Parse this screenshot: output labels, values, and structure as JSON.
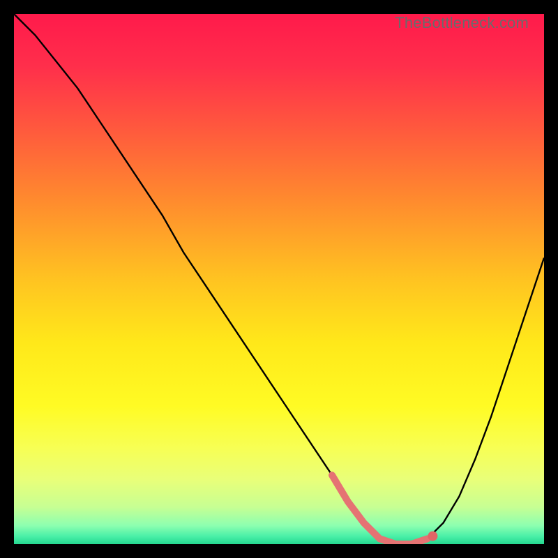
{
  "watermark": "TheBottleneck.com",
  "gradient_stops": [
    {
      "offset": 0.0,
      "color": "#ff1a4b"
    },
    {
      "offset": 0.1,
      "color": "#ff2f4b"
    },
    {
      "offset": 0.22,
      "color": "#ff5a3d"
    },
    {
      "offset": 0.35,
      "color": "#ff8a2e"
    },
    {
      "offset": 0.5,
      "color": "#ffc321"
    },
    {
      "offset": 0.62,
      "color": "#ffe81a"
    },
    {
      "offset": 0.74,
      "color": "#fffb24"
    },
    {
      "offset": 0.82,
      "color": "#f7ff55"
    },
    {
      "offset": 0.88,
      "color": "#e8ff7a"
    },
    {
      "offset": 0.93,
      "color": "#c7ff93"
    },
    {
      "offset": 0.965,
      "color": "#8dffb0"
    },
    {
      "offset": 0.985,
      "color": "#4bf0a8"
    },
    {
      "offset": 1.0,
      "color": "#24d890"
    }
  ],
  "chart_data": {
    "type": "line",
    "title": "",
    "xlabel": "",
    "ylabel": "",
    "xlim": [
      0,
      100
    ],
    "ylim": [
      0,
      100
    ],
    "series": [
      {
        "name": "bottleneck-curve",
        "x": [
          0,
          4,
          8,
          12,
          16,
          20,
          24,
          28,
          32,
          36,
          40,
          44,
          48,
          52,
          56,
          60,
          63,
          66,
          69,
          72,
          75,
          78,
          81,
          84,
          87,
          90,
          93,
          96,
          100
        ],
        "y": [
          100,
          96,
          91,
          86,
          80,
          74,
          68,
          62,
          55,
          49,
          43,
          37,
          31,
          25,
          19,
          13,
          8,
          4,
          1,
          0,
          0,
          1,
          4,
          9,
          16,
          24,
          33,
          42,
          54
        ]
      }
    ],
    "marker_band": {
      "x_start": 60,
      "x_end": 79,
      "color": "#e57373"
    },
    "marker_dot": {
      "x": 79,
      "y": 1.5,
      "color": "#e06666"
    }
  }
}
